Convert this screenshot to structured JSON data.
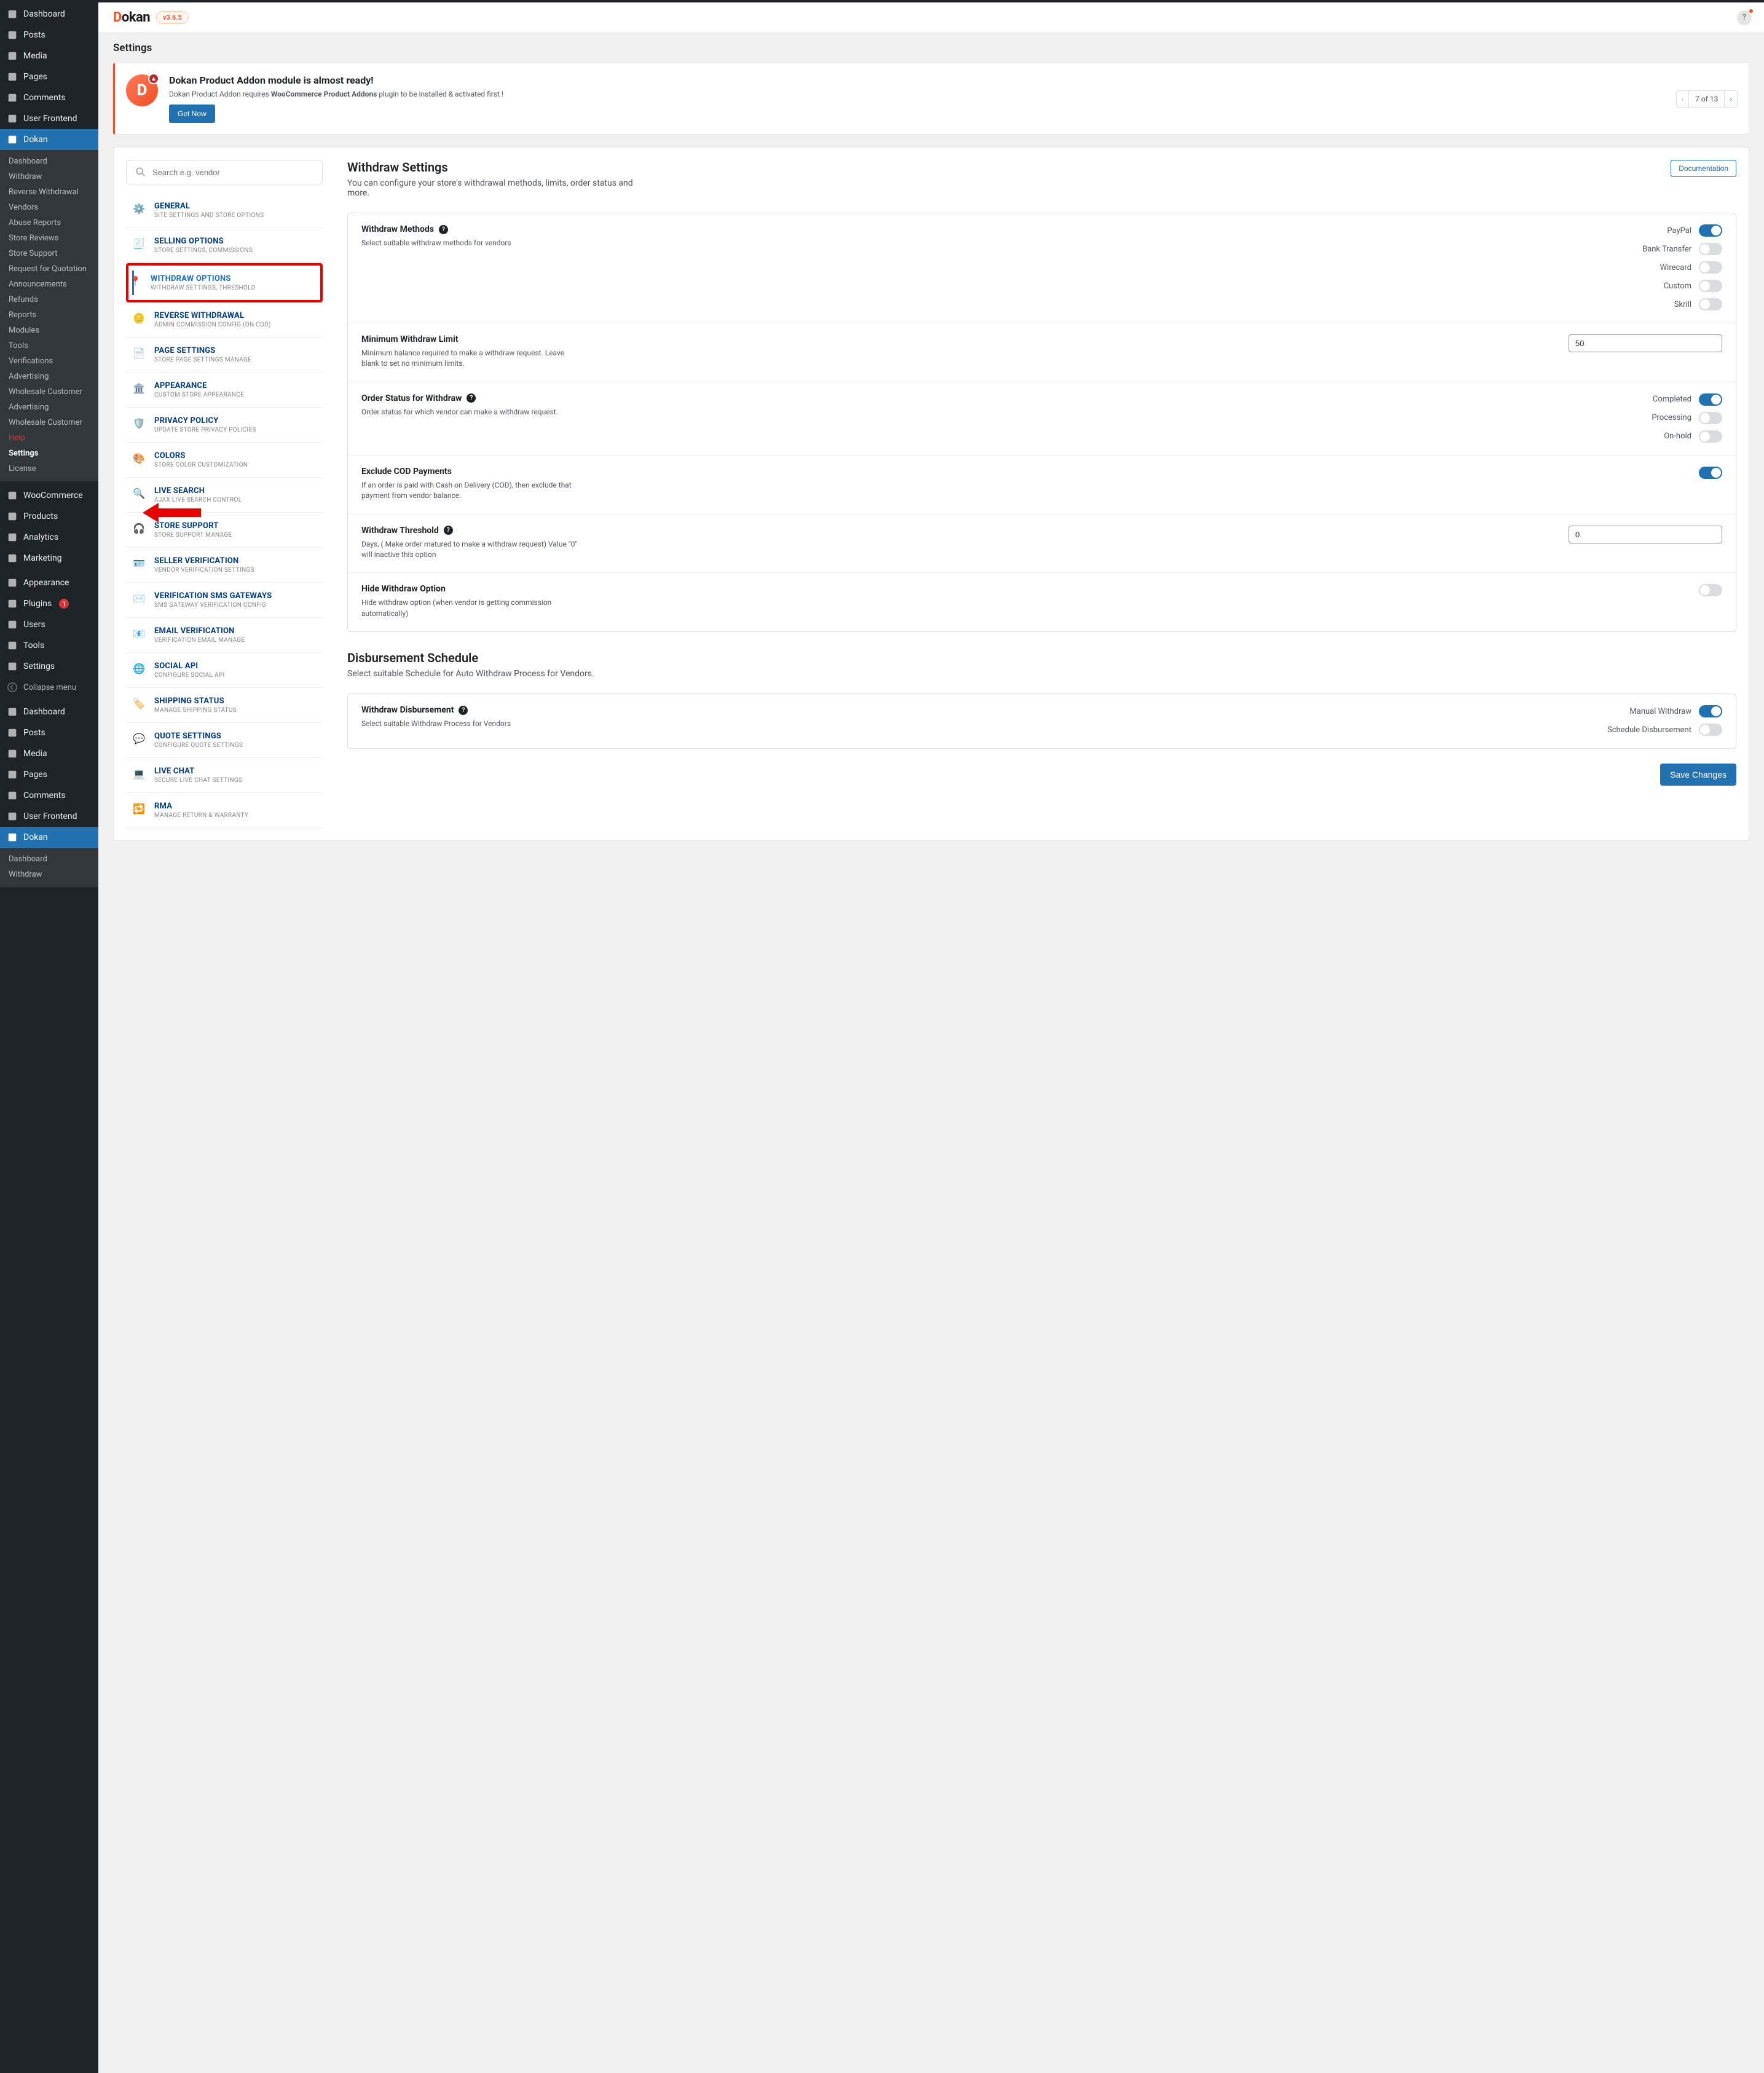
{
  "brand": {
    "name": "Dokan",
    "version": "v3.6.5"
  },
  "screen_title": "Settings",
  "help_icon_label": "?",
  "notice": {
    "title": "Dokan Product Addon module is almost ready!",
    "text_prefix": "Dokan Product Addon requires ",
    "text_bold": "WooCommerce Product Addons",
    "text_suffix": " plugin to be installed & activated first !",
    "button": "Get Now",
    "pager": {
      "current": 7,
      "total": 13,
      "of_label": "of"
    }
  },
  "wp_menu_primary": [
    {
      "label": "Dashboard"
    },
    {
      "label": "Posts"
    },
    {
      "label": "Media"
    },
    {
      "label": "Pages"
    },
    {
      "label": "Comments"
    },
    {
      "label": "User Frontend"
    },
    {
      "label": "Dokan",
      "active": true
    }
  ],
  "dokan_submenu": [
    {
      "label": "Dashboard"
    },
    {
      "label": "Withdraw"
    },
    {
      "label": "Reverse Withdrawal"
    },
    {
      "label": "Vendors"
    },
    {
      "label": "Abuse Reports"
    },
    {
      "label": "Store Reviews"
    },
    {
      "label": "Store Support"
    },
    {
      "label": "Request for Quotation"
    },
    {
      "label": "Announcements"
    },
    {
      "label": "Refunds"
    },
    {
      "label": "Reports"
    },
    {
      "label": "Modules"
    },
    {
      "label": "Tools"
    },
    {
      "label": "Verifications"
    },
    {
      "label": "Advertising"
    },
    {
      "label": "Wholesale Customer",
      "truncated": true
    },
    {
      "label": "Advertising"
    },
    {
      "label": "Wholesale Customer"
    },
    {
      "label": "Help",
      "help": true
    },
    {
      "label": "Settings",
      "selected": true
    },
    {
      "label": "License"
    }
  ],
  "wp_menu_secondary": [
    {
      "label": "WooCommerce"
    },
    {
      "label": "Products"
    },
    {
      "label": "Analytics"
    },
    {
      "label": "Marketing"
    }
  ],
  "wp_menu_tertiary": [
    {
      "label": "Appearance"
    },
    {
      "label": "Plugins",
      "badge": "1"
    },
    {
      "label": "Users"
    },
    {
      "label": "Tools"
    },
    {
      "label": "Settings"
    }
  ],
  "wp_collapse": "Collapse menu",
  "wp_menu_repeat": [
    {
      "label": "Dashboard"
    },
    {
      "label": "Posts"
    },
    {
      "label": "Media"
    },
    {
      "label": "Pages"
    },
    {
      "label": "Comments"
    },
    {
      "label": "User Frontend"
    },
    {
      "label": "Dokan",
      "active": true
    }
  ],
  "dokan_submenu_repeat": [
    {
      "label": "Dashboard"
    },
    {
      "label": "Withdraw"
    }
  ],
  "search_placeholder": "Search e.g. vendor",
  "settings_nav": [
    {
      "title": "GENERAL",
      "sub": "SITE SETTINGS AND STORE OPTIONS",
      "icon": "⚙️"
    },
    {
      "title": "SELLING OPTIONS",
      "sub": "STORE SETTINGS, COMMISSIONS",
      "icon": "🧾"
    },
    {
      "title": "WITHDRAW OPTIONS",
      "sub": "WITHDRAW SETTINGS, THRESHOLD",
      "selected": true,
      "highlight": true,
      "icon": "📍"
    },
    {
      "title": "REVERSE WITHDRAWAL",
      "sub": "ADMIN COMMISSION CONFIG (ON COD)",
      "icon": "🪙"
    },
    {
      "title": "PAGE SETTINGS",
      "sub": "STORE PAGE SETTINGS MANAGE",
      "icon": "📄"
    },
    {
      "title": "APPEARANCE",
      "sub": "CUSTOM STORE APPEARANCE",
      "icon": "🏛️"
    },
    {
      "title": "PRIVACY POLICY",
      "sub": "UPDATE STORE PRIVACY POLICIES",
      "icon": "🛡️"
    },
    {
      "title": "COLORS",
      "sub": "STORE COLOR CUSTOMIZATION",
      "icon": "🎨"
    },
    {
      "title": "LIVE SEARCH",
      "sub": "AJAX LIVE SEARCH CONTROL",
      "icon": "🔍"
    },
    {
      "title": "STORE SUPPORT",
      "sub": "STORE SUPPORT MANAGE",
      "icon": "🎧"
    },
    {
      "title": "SELLER VERIFICATION",
      "sub": "VENDOR VERIFICATION SETTINGS",
      "icon": "🪪"
    },
    {
      "title": "VERIFICATION SMS GATEWAYS",
      "sub": "SMS GATEWAY VERIFICATION CONFIG",
      "icon": "✉️"
    },
    {
      "title": "EMAIL VERIFICATION",
      "sub": "VERIFICATION EMAIL MANAGE",
      "icon": "📧"
    },
    {
      "title": "SOCIAL API",
      "sub": "CONFIGURE SOCIAL API",
      "icon": "🌐"
    },
    {
      "title": "SHIPPING STATUS",
      "sub": "MANAGE SHIPPING STATUS",
      "icon": "🏷️"
    },
    {
      "title": "QUOTE SETTINGS",
      "sub": "CONFIGURE QUOTE SETTINGS",
      "icon": "💬"
    },
    {
      "title": "LIVE CHAT",
      "sub": "SECURE LIVE CHAT SETTINGS",
      "icon": "💻"
    },
    {
      "title": "RMA",
      "sub": "MANAGE RETURN & WARRANTY",
      "icon": "🔁"
    }
  ],
  "withdraw": {
    "heading": "Withdraw Settings",
    "heading_sub": "You can configure your store's withdrawal methods, limits, order status and more.",
    "doc_button": "Documentation",
    "methods": {
      "label": "Withdraw Methods",
      "desc": "Select suitable withdraw methods for vendors",
      "items": [
        {
          "name": "PayPal",
          "on": true
        },
        {
          "name": "Bank Transfer",
          "on": false
        },
        {
          "name": "Wirecard",
          "on": false
        },
        {
          "name": "Custom",
          "on": false
        },
        {
          "name": "Skrill",
          "on": false
        }
      ]
    },
    "min_limit": {
      "label": "Minimum Withdraw Limit",
      "desc": "Minimum balance required to make a withdraw request. Leave blank to set no minimum limits.",
      "value": "50"
    },
    "order_status": {
      "label": "Order Status for Withdraw",
      "desc": "Order status for which vendor can make a withdraw request.",
      "items": [
        {
          "name": "Completed",
          "on": true
        },
        {
          "name": "Processing",
          "on": false
        },
        {
          "name": "On-hold",
          "on": false
        }
      ]
    },
    "exclude_cod": {
      "label": "Exclude COD Payments",
      "desc": "If an order is paid with Cash on Delivery (COD), then exclude that payment from vendor balance.",
      "on": true
    },
    "threshold": {
      "label": "Withdraw Threshold",
      "desc": "Days, ( Make order matured to make a withdraw request) Value \"0\" will inactive this option",
      "value": "0"
    },
    "hide_option": {
      "label": "Hide Withdraw Option",
      "desc": "Hide withdraw option (when vendor is getting commission automatically)",
      "on": false
    }
  },
  "disbursement": {
    "heading": "Disbursement Schedule",
    "heading_sub": "Select suitable Schedule for Auto Withdraw Process for Vendors.",
    "label": "Withdraw Disbursement",
    "desc": "Select suitable Withdraw Process for Vendors",
    "items": [
      {
        "name": "Manual Withdraw",
        "on": true
      },
      {
        "name": "Schedule Disbursement",
        "on": false
      }
    ]
  },
  "save_button": "Save Changes"
}
